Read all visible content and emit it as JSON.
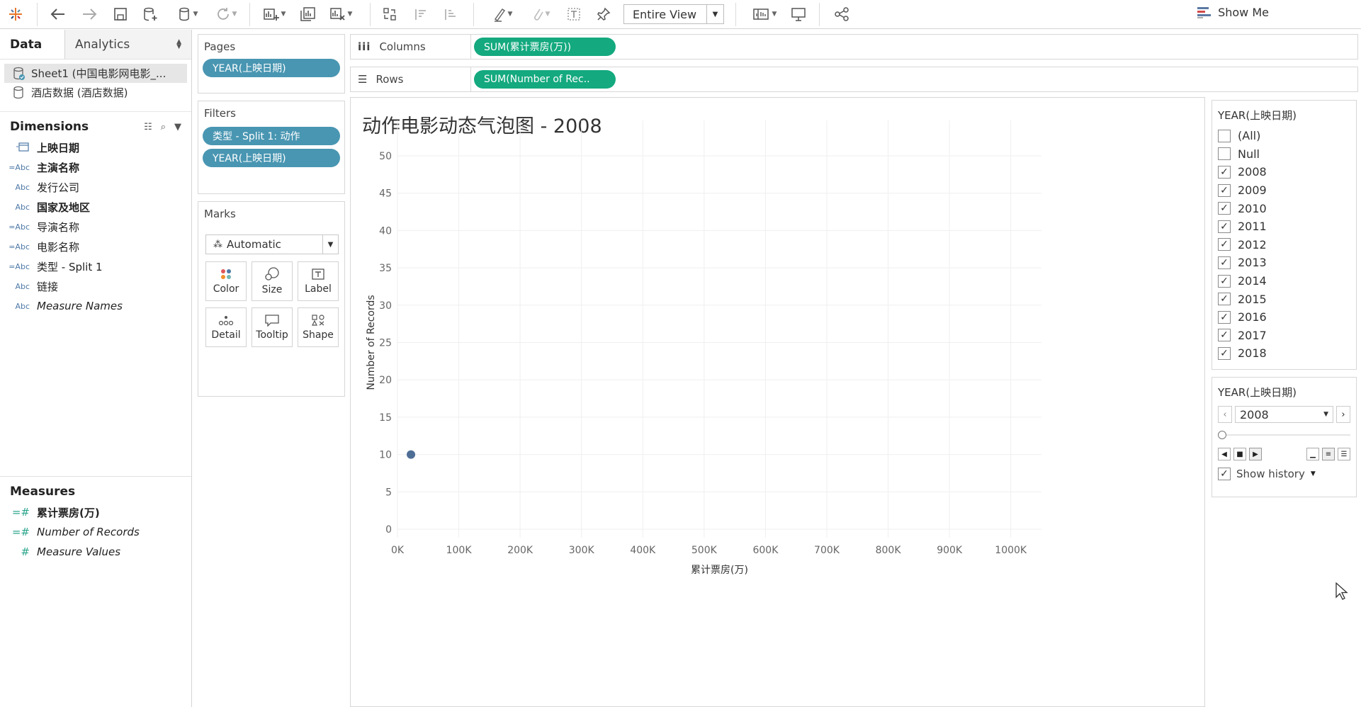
{
  "toolbar": {
    "fit_value": "Entire View",
    "show_me_label": "Show Me"
  },
  "data_pane": {
    "tab_data": "Data",
    "tab_analytics": "Analytics",
    "datasources": [
      {
        "label": "Sheet1 (中国电影网电影_..."
      },
      {
        "label": "酒店数据 (酒店数据)"
      }
    ],
    "dimensions_title": "Dimensions",
    "dimensions": [
      {
        "type": "date",
        "name": "上映日期"
      },
      {
        "type": "=Abc",
        "name": "主演名称"
      },
      {
        "type": "Abc",
        "name": "发行公司"
      },
      {
        "type": "Abc",
        "name": "国家及地区"
      },
      {
        "type": "=Abc",
        "name": "导演名称"
      },
      {
        "type": "=Abc",
        "name": "电影名称"
      },
      {
        "type": "=Abc",
        "name": "类型 - Split 1"
      },
      {
        "type": "Abc",
        "name": "链接"
      },
      {
        "type": "Abc",
        "name": "Measure Names"
      }
    ],
    "measures_title": "Measures",
    "measures": [
      {
        "type": "=#",
        "name": "累计票房(万)"
      },
      {
        "type": "=#",
        "name": "Number of Records"
      },
      {
        "type": "#",
        "name": "Measure Values"
      }
    ]
  },
  "pages_card": {
    "title": "Pages",
    "pill": "YEAR(上映日期)"
  },
  "filters_card": {
    "title": "Filters",
    "pills": [
      "类型 - Split 1: 动作",
      "YEAR(上映日期)"
    ]
  },
  "marks_card": {
    "title": "Marks",
    "mark_type": "Automatic",
    "buttons": [
      "Color",
      "Size",
      "Label",
      "Detail",
      "Tooltip",
      "Shape"
    ]
  },
  "columns_shelf": {
    "label": "Columns",
    "pill": "SUM(累计票房(万))"
  },
  "rows_shelf": {
    "label": "Rows",
    "pill": "SUM(Number of Rec.."
  },
  "viz": {
    "title": "动作电影动态气泡图 - 2008"
  },
  "chart_data": {
    "type": "scatter",
    "title": "动作电影动态气泡图 - 2008",
    "xlabel": "累计票房(万)",
    "ylabel": "Number of Records",
    "xlim": [
      0,
      1050000
    ],
    "ylim": [
      0,
      50
    ],
    "x_ticks": [
      0,
      100000,
      200000,
      300000,
      400000,
      500000,
      600000,
      700000,
      800000,
      900000,
      1000000
    ],
    "x_tick_labels": [
      "0K",
      "100K",
      "200K",
      "300K",
      "400K",
      "500K",
      "600K",
      "700K",
      "800K",
      "900K",
      "1000K"
    ],
    "y_ticks": [
      0,
      5,
      10,
      15,
      20,
      25,
      30,
      35,
      40,
      45,
      50
    ],
    "grid": true,
    "color": "#4e6e96",
    "points": [
      {
        "x": 22000,
        "y": 10
      }
    ]
  },
  "year_filter": {
    "title": "YEAR(上映日期)",
    "items": [
      {
        "label": "(All)",
        "checked": false
      },
      {
        "label": "Null",
        "checked": false
      },
      {
        "label": "2008",
        "checked": true
      },
      {
        "label": "2009",
        "checked": true
      },
      {
        "label": "2010",
        "checked": true
      },
      {
        "label": "2011",
        "checked": true
      },
      {
        "label": "2012",
        "checked": true
      },
      {
        "label": "2013",
        "checked": true
      },
      {
        "label": "2014",
        "checked": true
      },
      {
        "label": "2015",
        "checked": true
      },
      {
        "label": "2016",
        "checked": true
      },
      {
        "label": "2017",
        "checked": true
      },
      {
        "label": "2018",
        "checked": true
      }
    ]
  },
  "page_control": {
    "title": "YEAR(上映日期)",
    "current": "2008",
    "show_history_label": "Show history",
    "show_history_checked": true
  }
}
